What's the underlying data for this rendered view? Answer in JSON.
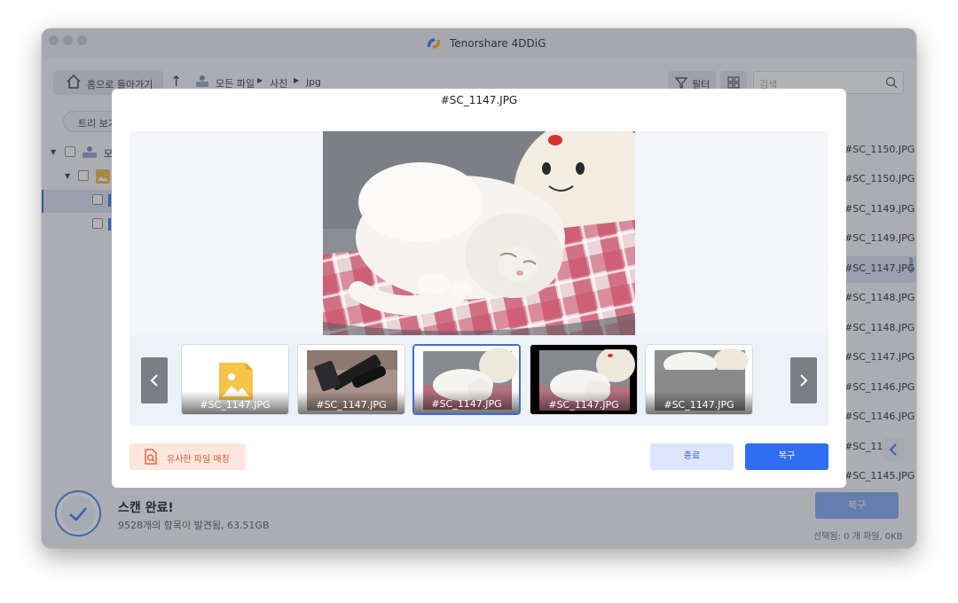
{
  "window": {
    "app_title": "Tenorshare 4DDiG"
  },
  "toolbar": {
    "home_label": "홈으로 돌아가기",
    "breadcrumb": [
      "모든 파일",
      "사진",
      "jpg"
    ],
    "filter_label": "필터",
    "search_placeholder": "검색"
  },
  "sidebar": {
    "tree_view_label": "트리 보기",
    "root_label": "모"
  },
  "file_list": [
    "#SC_1150.JPG",
    "#SC_1150.JPG",
    "#SC_1149.JPG",
    "#SC_1149.JPG",
    "#SC_1147.JPG",
    "#SC_1148.JPG",
    "#SC_1148.JPG",
    "#SC_1147.JPG",
    "#SC_1146.JPG",
    "#SC_1146.JPG",
    "#SC_114",
    "#SC_1145.JPG"
  ],
  "status": {
    "title": "스캔 완료!",
    "subtitle": "9528개의 항목이 발견됨, 63.51GB",
    "recover_label": "복구",
    "selected_info": "선택됨: 0 개 파일, 0KB"
  },
  "modal": {
    "title": "#SC_1147.JPG",
    "thumbnails": [
      {
        "caption": "#SC_1147.JPG",
        "kind": "placeholder-image-icon"
      },
      {
        "caption": "#SC_1147.JPG",
        "kind": "camera-photo"
      },
      {
        "caption": "#SC_1147.JPG",
        "kind": "cat-photo",
        "active": true
      },
      {
        "caption": "#SC_1147.JPG",
        "kind": "cat-photo-dark"
      },
      {
        "caption": "#SC_1147.JPG",
        "kind": "cat-photo-partial"
      }
    ],
    "similar_label": "유사한 파일 매칭",
    "close_label": "종료",
    "recover_label": "복구"
  },
  "colors": {
    "accent": "#2f6ef2",
    "similar_text": "#e4572e"
  }
}
